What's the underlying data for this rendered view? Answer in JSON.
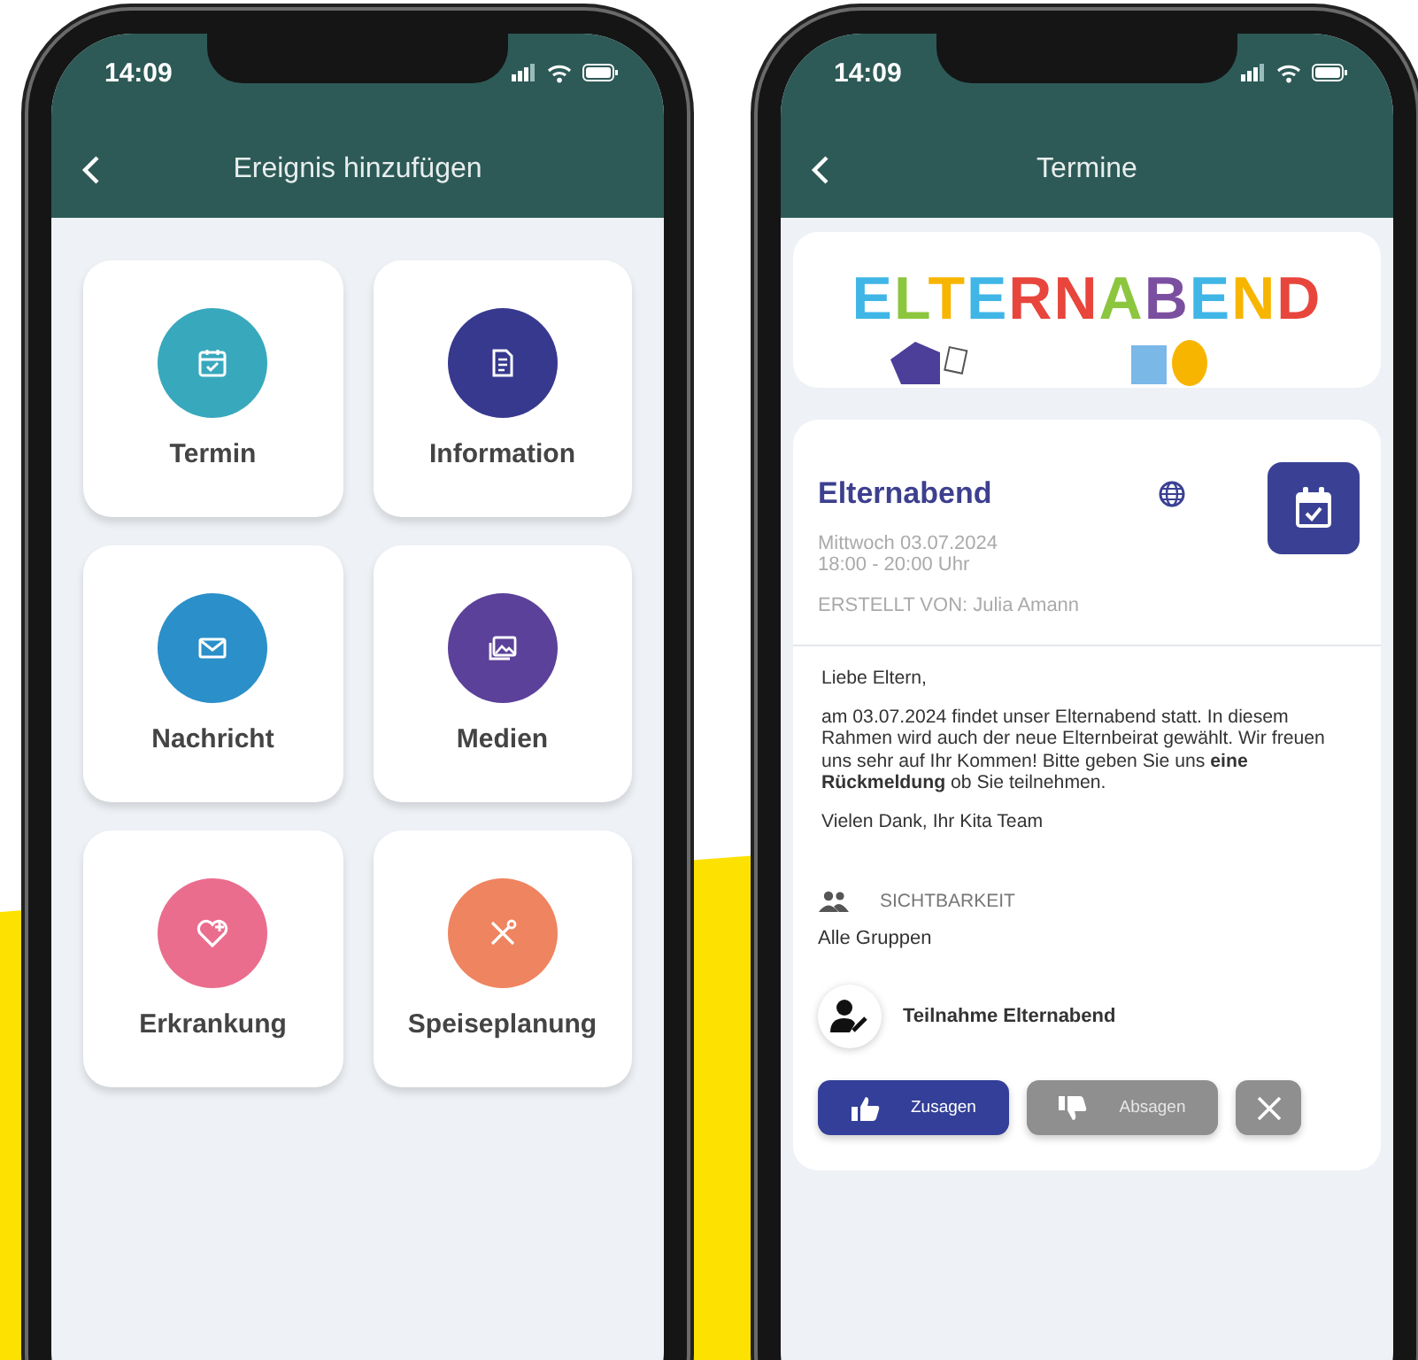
{
  "left_screen": {
    "status_bar": {
      "time": "14:09"
    },
    "header": {
      "title": "Ereignis hinzufügen"
    },
    "tiles": [
      {
        "label": "Termin",
        "kind": "calendar",
        "color": "#38a8bd"
      },
      {
        "label": "Information",
        "kind": "document",
        "color": "#37398f"
      },
      {
        "label": "Nachricht",
        "kind": "mail",
        "color": "#2b8fc9"
      },
      {
        "label": "Medien",
        "kind": "images",
        "color": "#5b4199"
      },
      {
        "label": "Erkrankung",
        "kind": "heart",
        "color": "#ea6d8e"
      },
      {
        "label": "Speiseplanung",
        "kind": "cutlery",
        "color": "#ef8460"
      }
    ]
  },
  "right_screen": {
    "status_bar": {
      "time": "14:09"
    },
    "header": {
      "title": "Termine"
    },
    "banner": {
      "text": "ELTERNABEND"
    },
    "event": {
      "title": "Elternabend",
      "date": "Mittwoch 03.07.2024",
      "time": "18:00 - 20:00 Uhr",
      "created_by": "ERSTELLT VON: Julia Amann",
      "message": [
        "Liebe Eltern,",
        "am 03.07.2024 findet unser Elternabend statt. In diesem Rahmen wird auch der neue Elternbeirat gewählt. Wir freuen uns sehr auf Ihr Kommen! Bitte geben Sie uns **eine Rückmeldung** ob Sie teilnehmen.",
        "Vielen Dank, Ihr Kita Team"
      ],
      "visibility": {
        "label": "SICHTBARKEIT",
        "value": "Alle Gruppen"
      },
      "participation": {
        "title": "Teilnahme Elternabend",
        "buttons": [
          {
            "label": "Zusagen",
            "kind": "accept",
            "selected": true
          },
          {
            "label": "Absagen",
            "kind": "decline",
            "selected": false
          }
        ]
      }
    }
  }
}
